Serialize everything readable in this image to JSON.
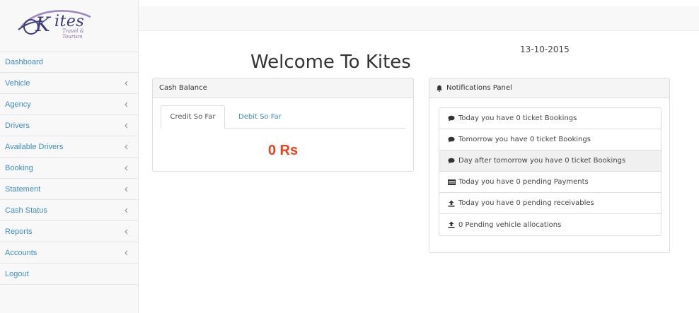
{
  "brand": {
    "name": "ites",
    "subtitle": "Travel & Tourism",
    "logo_color": "#3b3b7a"
  },
  "sidebar": {
    "items": [
      {
        "label": "Dashboard",
        "has_chevron": false
      },
      {
        "label": "Vehicle",
        "has_chevron": true
      },
      {
        "label": "Agency",
        "has_chevron": true
      },
      {
        "label": "Drivers",
        "has_chevron": true
      },
      {
        "label": "Available Drivers",
        "has_chevron": true
      },
      {
        "label": "Booking",
        "has_chevron": true
      },
      {
        "label": "Statement",
        "has_chevron": true
      },
      {
        "label": "Cash Status",
        "has_chevron": true
      },
      {
        "label": "Reports",
        "has_chevron": true
      },
      {
        "label": "Accounts",
        "has_chevron": true
      },
      {
        "label": "Logout",
        "has_chevron": false
      }
    ],
    "link_color": "#3c8dcb"
  },
  "main": {
    "title": "Welcome To Kites",
    "date": "13-10-2015"
  },
  "cash_panel": {
    "heading": "Cash Balance",
    "tabs": [
      {
        "label": "Credit So Far",
        "active": true
      },
      {
        "label": "Debit So Far",
        "active": false
      }
    ],
    "amount": "0 Rs",
    "amount_color": "#e8431b"
  },
  "notifications": {
    "heading": "Notifications Panel",
    "heading_icon": "bell-icon",
    "items": [
      {
        "icon": "comment-icon",
        "text": "Today you have 0 ticket Bookings"
      },
      {
        "icon": "comment-icon",
        "text": "Tomorrow you have 0 ticket Bookings"
      },
      {
        "icon": "comment-icon",
        "text": "Day after tomorrow you have 0 ticket Bookings"
      },
      {
        "icon": "money-icon",
        "text": "Today you have 0 pending Payments"
      },
      {
        "icon": "upload-icon",
        "text": "Today you have 0 pending receivables"
      },
      {
        "icon": "upload-icon",
        "text": "0 Pending vehicle allocations"
      }
    ]
  }
}
